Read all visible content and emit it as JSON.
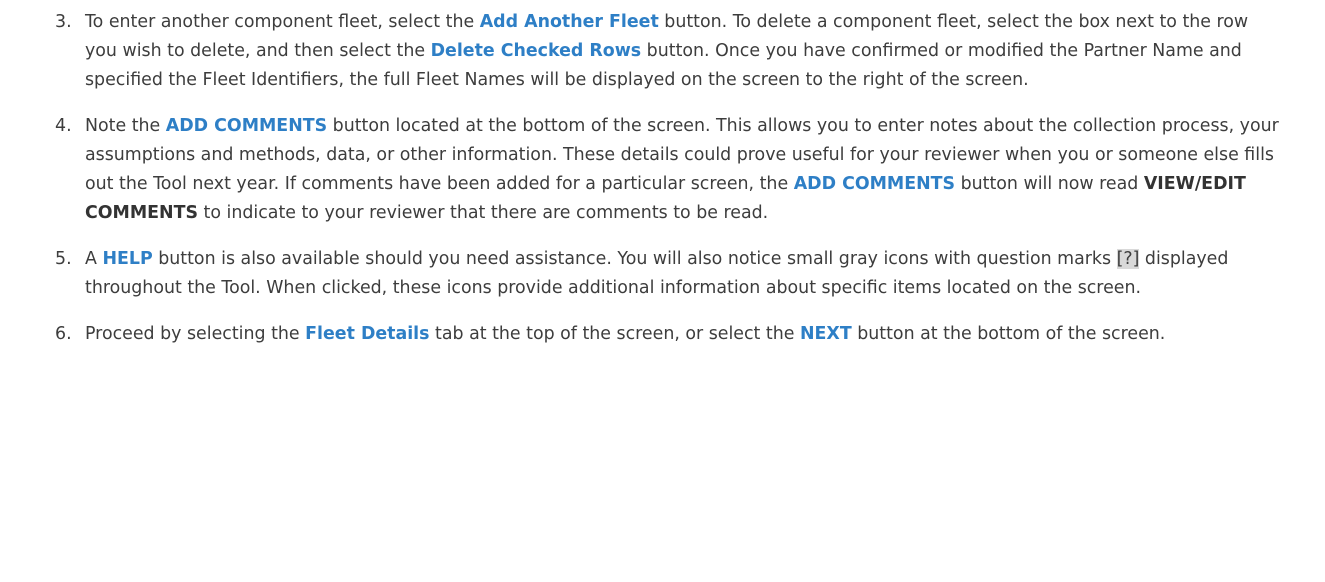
{
  "steps": [
    {
      "number": "3.",
      "parts": [
        {
          "text": "To enter another component fleet, select the "
        },
        {
          "text": "Add Another Fleet",
          "style": "hl",
          "name": "add-another-fleet-ref"
        },
        {
          "text": " button. To delete a component fleet, select the box next to the row you wish to delete, and then select the "
        },
        {
          "text": "Delete Checked Rows",
          "style": "hl",
          "name": "delete-checked-rows-ref"
        },
        {
          "text": " button. Once you have confirmed or modified the Partner Name and specified the Fleet Identifiers, the full Fleet Names will be displayed on the screen to the right of the screen."
        }
      ]
    },
    {
      "number": "4.",
      "parts": [
        {
          "text": "Note the "
        },
        {
          "text": "ADD COMMENTS",
          "style": "hl",
          "name": "add-comments-ref"
        },
        {
          "text": " button located at the bottom of the screen. This allows you to enter notes about the collection process, your assumptions and methods, data, or other information. These details could prove useful for your reviewer when you or someone else fills out the Tool next year. If comments have been added for a particular screen, the "
        },
        {
          "text": "ADD COMMENTS",
          "style": "hl",
          "name": "add-comments-ref"
        },
        {
          "text": " button will now read "
        },
        {
          "text": "VIEW/EDIT COMMENTS",
          "style": "bd",
          "name": "view-edit-comments-ref"
        },
        {
          "text": " to indicate to your reviewer that there are comments to be read."
        }
      ]
    },
    {
      "number": "5.",
      "parts": [
        {
          "text": "A "
        },
        {
          "text": "HELP",
          "style": "hl",
          "name": "help-ref"
        },
        {
          "text": " button is also available should you need assistance. You will also notice small gray icons with question marks "
        },
        {
          "text": "[?]",
          "style": "qmark",
          "name": "question-mark-icon"
        },
        {
          "text": " displayed throughout the Tool. When clicked, these icons provide additional information about specific items located on the screen."
        }
      ]
    },
    {
      "number": "6.",
      "parts": [
        {
          "text": "Proceed by selecting the "
        },
        {
          "text": "Fleet Details",
          "style": "hl",
          "name": "fleet-details-ref"
        },
        {
          "text": " tab at the top of the screen, or select the "
        },
        {
          "text": "NEXT",
          "style": "hl",
          "name": "next-ref"
        },
        {
          "text": " button at the bottom of the screen."
        }
      ]
    }
  ]
}
